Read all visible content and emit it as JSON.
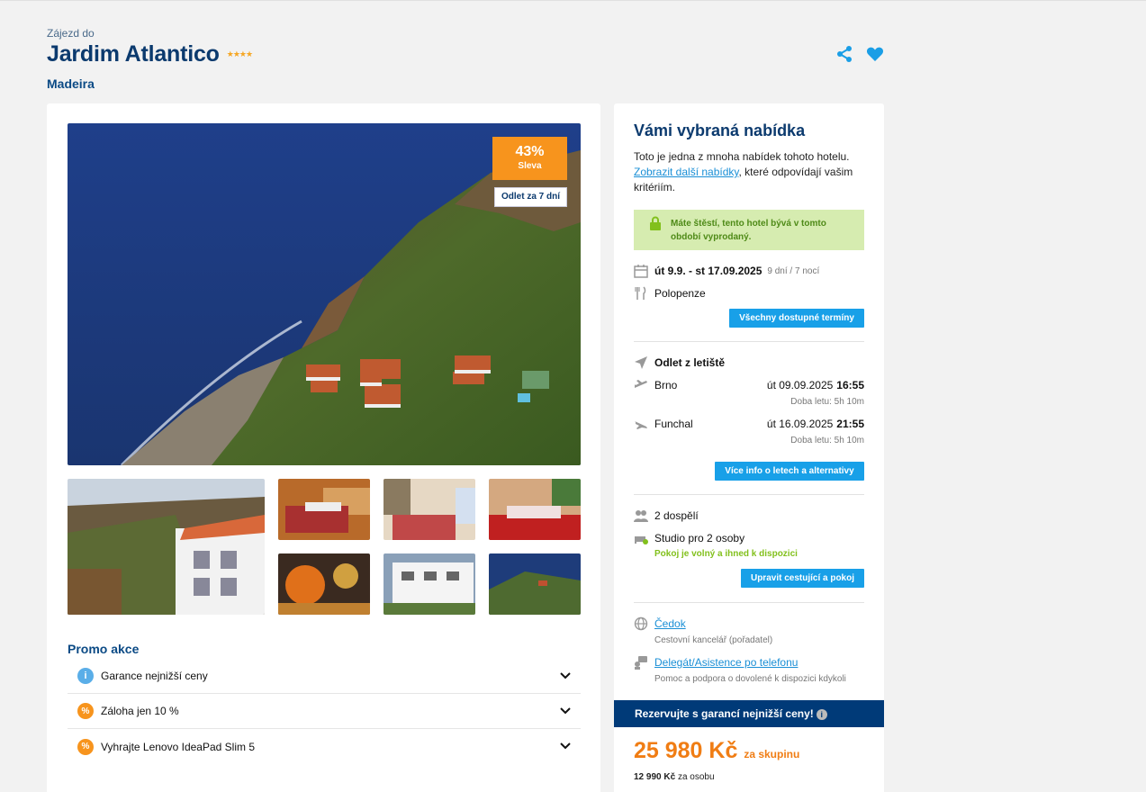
{
  "header": {
    "pretitle": "Zájezd do",
    "title": "Jardim Atlantico",
    "stars": "★★★★",
    "region": "Madeira"
  },
  "gallery": {
    "discount_pct": "43%",
    "discount_label": "Sleva",
    "departure_badge": "Odlet za 7 dní"
  },
  "promo": {
    "title": "Promo akce",
    "items": [
      {
        "icon": "info-icon",
        "label": "Garance nejnižší ceny"
      },
      {
        "icon": "percent-icon",
        "label": "Záloha jen 10 %"
      },
      {
        "icon": "percent-icon",
        "label": "Vyhrajte Lenovo IdeaPad Slim 5"
      }
    ]
  },
  "offer": {
    "title": "Vámi vybraná nabídka",
    "desc_1": "Toto je jedna z mnoha nabídek tohoto hotelu.",
    "desc_link": "Zobrazit další nabídky",
    "desc_2": ", které odpovídají vašim kritériím.",
    "notice": "Máte štěstí, tento hotel bývá v tomto období vyprodaný.",
    "dates": "út 9.9. - st 17.09.2025",
    "duration": "9 dní / 7 nocí",
    "board": "Polopenze",
    "all_dates_button": "Všechny dostupné termíny",
    "flight_title": "Odlet z letiště",
    "flights": [
      {
        "city": "Brno",
        "date": "út 09.09.2025",
        "time": "16:55",
        "duration": "Doba letu: 5h 10m"
      },
      {
        "city": "Funchal",
        "date": "út 16.09.2025",
        "time": "21:55",
        "duration": "Doba letu: 5h 10m"
      }
    ],
    "flight_button": "Více info o letech a alternativy",
    "travellers": "2 dospělí",
    "room": "Studio pro 2 osoby",
    "room_status": "Pokoj je volný a ihned k dispozici",
    "edit_button": "Upravit cestující a pokoj",
    "agency_name": "Čedok",
    "agency_desc": "Cestovní kancelář (pořadatel)",
    "support_name": "Delegát/Asistence po telefonu",
    "support_desc": "Pomoc a podpora o dovolené k dispozici kdykoli",
    "band": "Rezervujte s garancí nejnižší ceny!",
    "price": "25 980 Kč",
    "price_unit": "za skupinu",
    "per_person_price": "12 990 Kč",
    "per_person_unit": "za osobu"
  },
  "colors": {
    "brand_blue": "#0b3a6e",
    "accent_blue": "#18a0e8",
    "orange": "#f7941d",
    "green_box": "#d6ecb0",
    "band": "#003a78"
  }
}
